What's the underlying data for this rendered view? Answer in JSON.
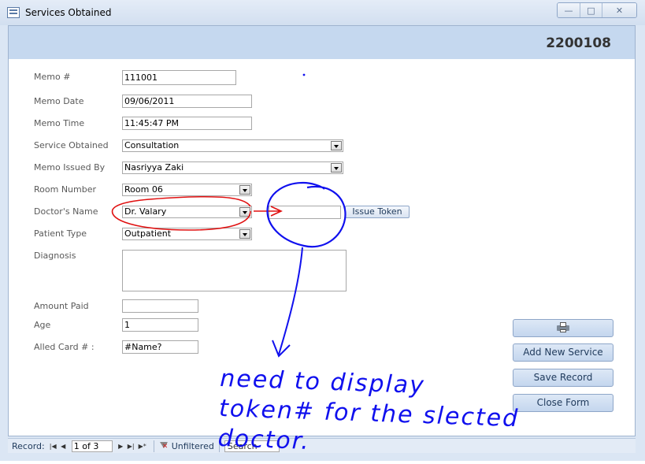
{
  "window": {
    "title": "Services Obtained",
    "min_label": "—",
    "max_label": "□",
    "close_label": "✕"
  },
  "header": {
    "record_id": "2200108"
  },
  "fields": {
    "memo_no": {
      "label": "Memo #",
      "value": "111001"
    },
    "memo_date": {
      "label": "Memo Date",
      "value": "09/06/2011"
    },
    "memo_time": {
      "label": "Memo Time",
      "value": "11:45:47 PM"
    },
    "service_obtained": {
      "label": "Service Obtained",
      "value": "Consultation"
    },
    "memo_issued_by": {
      "label": "Memo Issued By",
      "value": "Nasriyya Zaki"
    },
    "room_number": {
      "label": "Room Number",
      "value": "Room 06"
    },
    "doctors_name": {
      "label": "Doctor's Name",
      "value": "Dr. Valary"
    },
    "token": {
      "value": ""
    },
    "patient_type": {
      "label": "Patient Type",
      "value": "Outpatient"
    },
    "diagnosis": {
      "label": "Diagnosis",
      "value": ""
    },
    "amount_paid": {
      "label": "Amount Paid",
      "value": ""
    },
    "age": {
      "label": "Age",
      "value": "1"
    },
    "alled_card": {
      "label": "Alled Card # :",
      "value": "#Name?"
    }
  },
  "buttons": {
    "issue_token": "Issue Token",
    "print_icon": "printer-icon",
    "add_new_service": "Add New Service",
    "save_record": "Save Record",
    "close_form": "Close Form"
  },
  "navbar": {
    "record_label": "Record:",
    "first": "|◀",
    "prev": "◀",
    "position": "1 of 3",
    "next": "▶",
    "last": "▶|",
    "new": "▶*",
    "filter_label": "Unfiltered",
    "search_label": "Search"
  },
  "annotation": {
    "line1": "need to display",
    "line2": "token# for the slected",
    "line3": "doctor."
  },
  "colors": {
    "annotation_blue": "#1010ee",
    "annotation_red": "#e01010",
    "header_band": "#c5d8ef"
  }
}
